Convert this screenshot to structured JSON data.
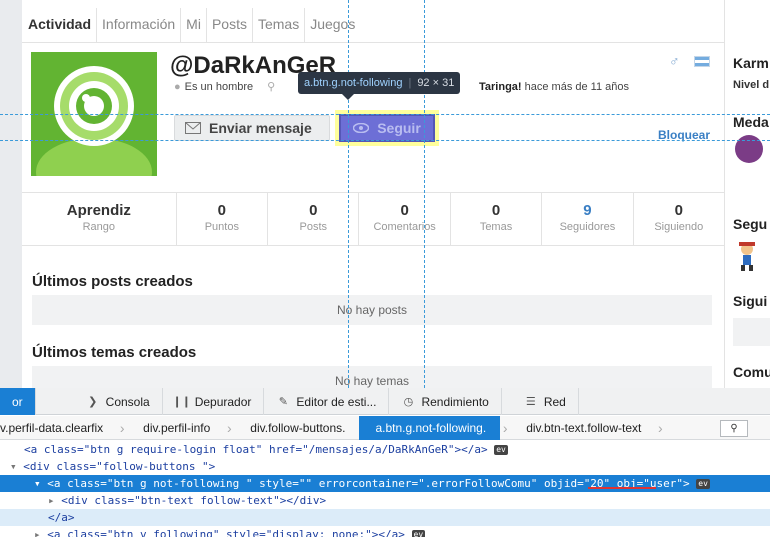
{
  "profile": {
    "tabs": [
      "Actividad",
      "Información",
      "Mi",
      "Posts",
      "Temas",
      "Juegos"
    ],
    "username": "@DaRkAnGeR",
    "gender_text": "Es un hombre",
    "meta_right_bold": "Taringa!",
    "meta_right_rest": "hace más de 11 años",
    "send_message_label": "Enviar mensaje",
    "follow_label": "Seguir",
    "block_label": "Bloquear",
    "stats": [
      {
        "value": "Aprendiz",
        "label": "Rango"
      },
      {
        "value": "0",
        "label": "Puntos"
      },
      {
        "value": "0",
        "label": "Posts"
      },
      {
        "value": "0",
        "label": "Comentarios"
      },
      {
        "value": "0",
        "label": "Temas"
      },
      {
        "value": "9",
        "label": "Seguidores"
      },
      {
        "value": "0",
        "label": "Siguiendo"
      }
    ],
    "posts_title": "Últimos posts creados",
    "posts_empty": "No hay posts",
    "topics_title": "Últimos temas creados",
    "topics_empty": "No hay temas"
  },
  "right_column": {
    "karma_title": "Karm",
    "karma_sub": "Nivel d",
    "medals_title": "Meda",
    "followers_title": "Segu",
    "following_title": "Sigui",
    "communities_title": "Comu"
  },
  "inspector_tooltip": {
    "selector": "a.btn.g.not-following",
    "size": "92 × 31"
  },
  "devtools": {
    "tabs": [
      {
        "label": "or",
        "icon": ""
      },
      {
        "label": "Consola",
        "icon": "console-icon"
      },
      {
        "label": "Depurador",
        "icon": "debugger-icon"
      },
      {
        "label": "Editor de esti...",
        "icon": "style-editor-icon"
      },
      {
        "label": "Rendimiento",
        "icon": "performance-icon"
      },
      {
        "label": "Red",
        "icon": "network-icon"
      }
    ],
    "breadcrumbs": [
      "v.perfil-data.clearfix",
      "div.perfil-info",
      "div.follow-buttons.",
      "a.btn.g.not-following.",
      "div.btn-text.follow-text"
    ],
    "code": {
      "line1": "<a class=\"btn g require-login float\" href=\"/mensajes/a/DaRkAnGeR\"></a>",
      "line2": "<div class=\"follow-buttons \">",
      "line3_prefix": "<a class=\"btn g not-following \" style=\"\" errorcontainer=\".errorFollowComu\" ",
      "line3_objid": "objid=\"20\"",
      "line3_suffix": " obj=\"user\">",
      "line4": "<div class=\"btn-text follow-text\"></div>",
      "line5": "</a>",
      "line6": "<a class=\"btn v following\" style=\"display: none;\"></a>",
      "ev_badge": "ev"
    }
  },
  "colors": {
    "accent_blue": "#1a7fd4",
    "avatar_green": "#62b432",
    "highlight_yellow": "#ffff9c",
    "follow_purple": "#6d6fd6",
    "link_blue": "#3a7fc4"
  }
}
